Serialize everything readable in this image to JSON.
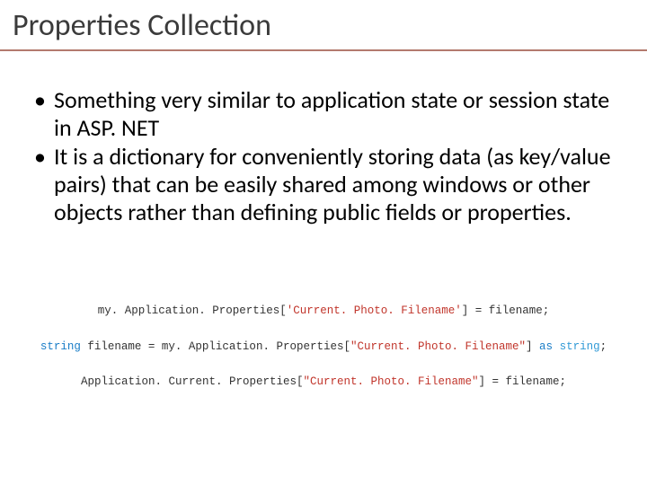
{
  "title": "Properties Collection",
  "bullets": [
    "Something very similar to application state or session state in ASP. NET",
    "It is a dictionary for conveniently storing data (as key/value pairs) that can be easily shared among windows or other objects rather than defining public fields or properties."
  ],
  "code": {
    "line1": {
      "prefix": "my. Application. Properties[",
      "string": "'Current. Photo. Filename'",
      "suffix": "] = filename;"
    },
    "line2": {
      "kw": "string",
      "mid": " filename = my. Application. Properties[",
      "string": "\"Current. Photo. Filename\"",
      "suffix1": "] ",
      "as": "as",
      "suffix2": " ",
      "type": "string",
      "suffix3": ";"
    },
    "line3": {
      "prefix": "Application. Current. Properties[",
      "string": "\"Current. Photo. Filename\"",
      "suffix": "] = filename;"
    }
  }
}
